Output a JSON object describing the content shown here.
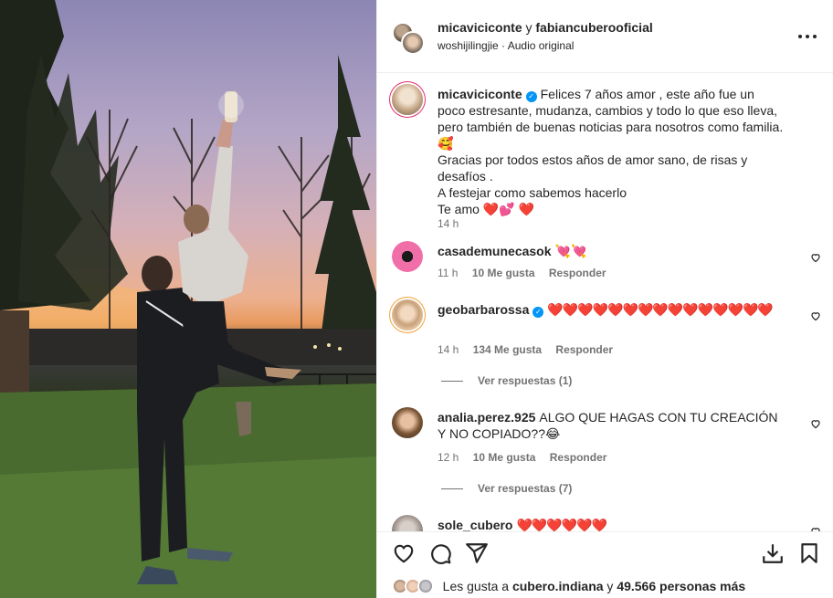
{
  "post": {
    "header": {
      "author_1": "micaviciconte",
      "joiner": "y",
      "author_2": "fabiancuberooficial",
      "audio_user": "woshijilingjie",
      "audio_dot": "·",
      "audio_label": "Audio original"
    },
    "caption": {
      "user": "micaviciconte",
      "text_1": "Felices 7 años amor , este año fue un poco estresante, mudanza, cambios y todo lo que eso lleva, pero también de buenas noticias para nosotros como familia. 🥰",
      "text_2": "Gracias por todos estos años de amor sano, de risas y desafíos .",
      "text_3": "A festejar como sabemos hacerlo",
      "text_4": "Te amo ❤️💕 ❤️",
      "time": "14 h"
    },
    "comments": [
      {
        "user": "casademunecasok",
        "text": "💘💘",
        "time": "11 h",
        "likes": "10 Me gusta",
        "reply": "Responder"
      },
      {
        "user": "geobarbarossa",
        "text": "❤️❤️❤️❤️❤️❤️❤️❤️❤️❤️❤️❤️❤️❤️❤️",
        "time": "14 h",
        "likes": "134 Me gusta",
        "reply": "Responder",
        "view_replies": "Ver respuestas (1)"
      },
      {
        "user": "analia.perez.925",
        "text": "ALGO QUE HAGAS CON TU CREACIÓN Y NO COPIADO??😂",
        "time": "12 h",
        "likes": "10 Me gusta",
        "reply": "Responder",
        "view_replies": "Ver respuestas (7)"
      },
      {
        "user": "sole_cubero",
        "text": "❤️❤️❤️❤️❤️❤️"
      }
    ],
    "likes_line": {
      "prefix": "Les gusta a",
      "user": "cubero.indiana",
      "joiner": "y",
      "count": "49.566 personas más"
    }
  },
  "icons": [
    "more-icon",
    "heart-icon",
    "comment-icon",
    "share-icon",
    "download-icon",
    "bookmark-icon",
    "verified-icon"
  ],
  "colors": {
    "verified": "#0095f6",
    "secondary_text": "#737373",
    "heart_red": "#e0245e"
  }
}
